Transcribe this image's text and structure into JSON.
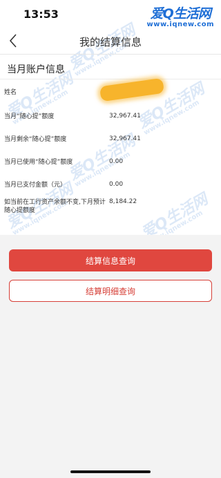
{
  "status_bar": {
    "time": "13:53"
  },
  "logo": {
    "name": "爱Q生活网",
    "url": "www.iqnew.com"
  },
  "nav": {
    "title": "我的结算信息"
  },
  "section": {
    "title": "当月账户信息"
  },
  "rows": [
    {
      "label": "姓名",
      "value": ""
    },
    {
      "label": "当月“随心提”额度",
      "value": "32,967.41"
    },
    {
      "label": "当月剩余“随心提”额度",
      "value": "32,967.41"
    },
    {
      "label": "当月已使用“随心提”额度",
      "value": "0.00"
    },
    {
      "label": "当月已支付金额（元）",
      "value": "0.00"
    },
    {
      "label": "如当前在工行资产余额不变,下月预计随心提额度",
      "value": "8,184.22"
    }
  ],
  "buttons": {
    "primary": "结算信息查询",
    "secondary": "结算明细查询"
  },
  "watermark": {
    "text": "爱Q生活网",
    "url": "www.iqnew.com"
  },
  "colors": {
    "primary_red": "#e0473f",
    "logo_blue": "#1f6fd6",
    "redaction": "#f7b42c"
  },
  "icons": {
    "back": "chevron-left-icon"
  }
}
